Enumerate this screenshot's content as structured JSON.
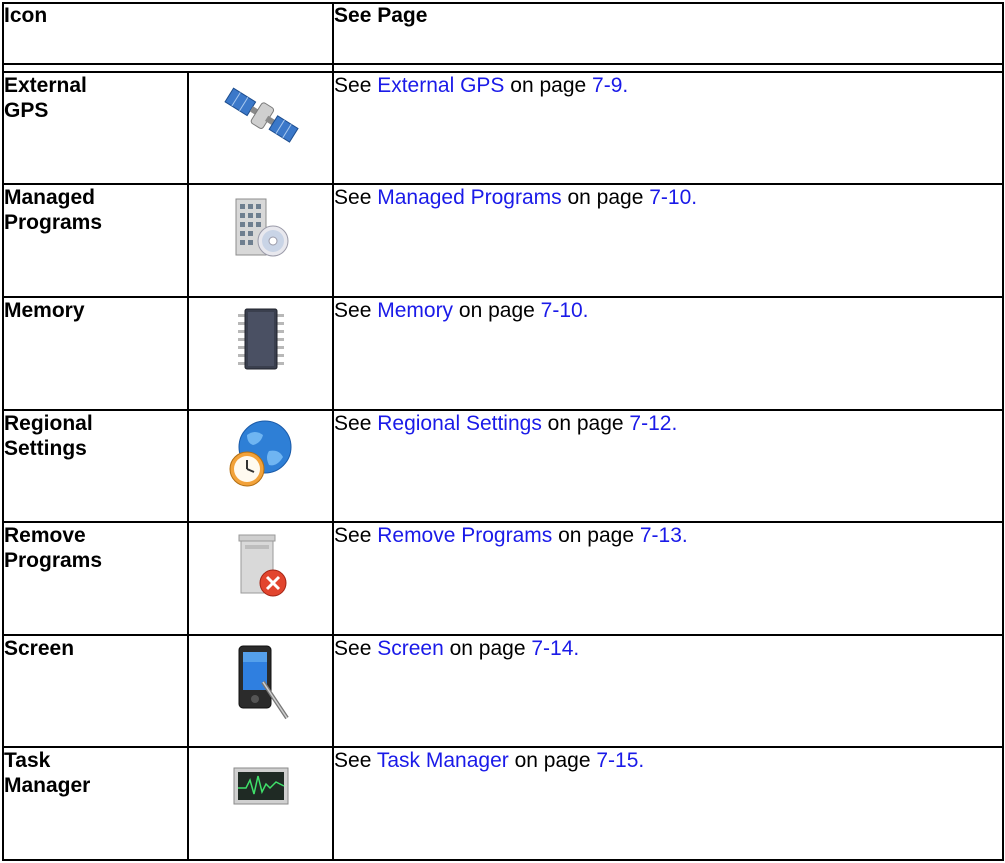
{
  "header": {
    "icon_col": "Icon",
    "see_col": "See Page"
  },
  "rows": [
    {
      "name": "External\nGPS",
      "icon": "satellite-icon",
      "prefix": "See ",
      "link": "External GPS",
      "mid": " on page ",
      "page": "7-9."
    },
    {
      "name": "Managed\nPrograms",
      "icon": "building-disc-icon",
      "prefix": "See ",
      "link": "Managed Programs",
      "mid": " on page ",
      "page": "7-10."
    },
    {
      "name": "Memory",
      "icon": "memory-chip-icon",
      "prefix": "See ",
      "link": "Memory",
      "mid": " on page ",
      "page": "7-10."
    },
    {
      "name": "Regional\nSettings",
      "icon": "globe-clock-icon",
      "prefix": "See ",
      "link": "Regional Settings",
      "mid": " on page ",
      "page": "7-12."
    },
    {
      "name": "Remove\nPrograms",
      "icon": "remove-programs-icon",
      "prefix": "See ",
      "link": "Remove Programs",
      "mid": " on page ",
      "page": "7-13."
    },
    {
      "name": "Screen",
      "icon": "stylus-device-icon",
      "prefix": "See ",
      "link": "Screen",
      "mid": " on page ",
      "page": "7-14."
    },
    {
      "name": "Task\nManager",
      "icon": "task-manager-icon",
      "prefix": "See ",
      "link": "Task Manager",
      "mid": " on page ",
      "page": "7-15."
    }
  ],
  "colors": {
    "link": "#1a1ae8",
    "border": "#000000"
  }
}
